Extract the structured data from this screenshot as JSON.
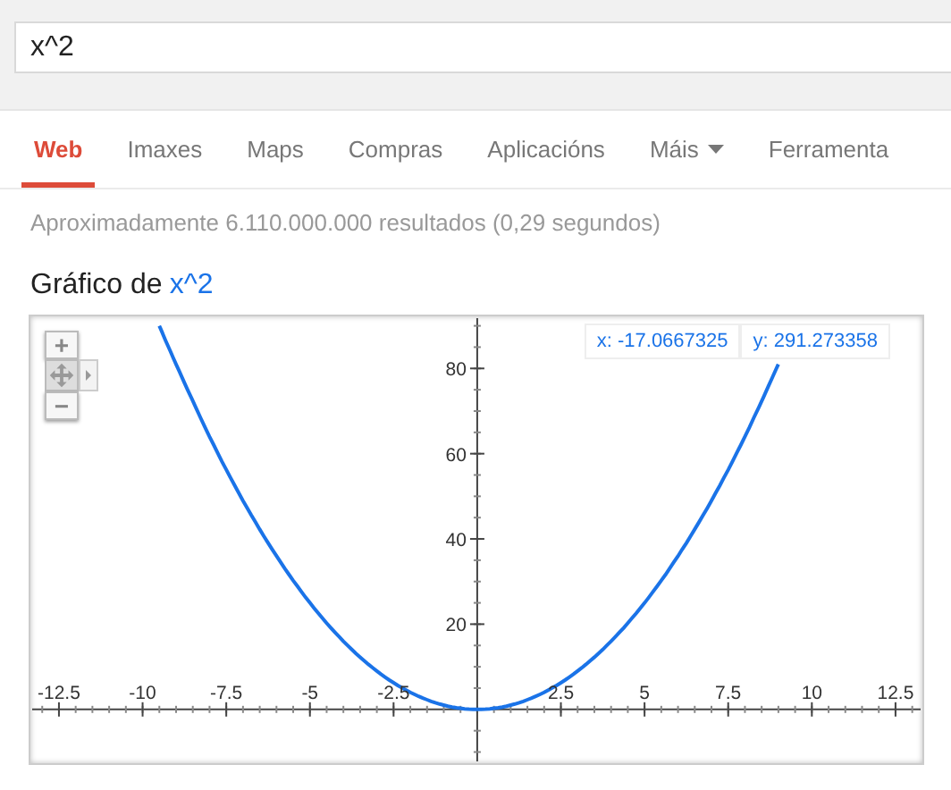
{
  "search": {
    "value": "x^2"
  },
  "tabs": [
    {
      "label": "Web",
      "selected": true,
      "kind": "plain"
    },
    {
      "label": "Imaxes",
      "selected": false,
      "kind": "plain"
    },
    {
      "label": "Maps",
      "selected": false,
      "kind": "plain"
    },
    {
      "label": "Compras",
      "selected": false,
      "kind": "plain"
    },
    {
      "label": "Aplicacións",
      "selected": false,
      "kind": "plain"
    },
    {
      "label": "Máis",
      "selected": false,
      "kind": "dropdown"
    },
    {
      "label": "Ferramenta",
      "selected": false,
      "kind": "plain"
    }
  ],
  "result_stats": "Aproximadamente 6.110.000.000 resultados (0,29 segundos)",
  "graph": {
    "title": "Gráfico de",
    "query": "x^2",
    "readout": {
      "x": "x: -17.0667325",
      "y": "y: 291.273358"
    },
    "chart_data": {
      "type": "line",
      "xlim": [
        -13.3,
        13.25
      ],
      "ylim": [
        -12.2,
        91.8
      ],
      "xticks": [
        {
          "value": -12.5,
          "label": "-12.5"
        },
        {
          "value": -10,
          "label": "-10"
        },
        {
          "value": -7.5,
          "label": "-7.5"
        },
        {
          "value": -5,
          "label": "-5"
        },
        {
          "value": -2.5,
          "label": "-2.5"
        },
        {
          "value": 2.5,
          "label": "2.5"
        },
        {
          "value": 5,
          "label": "5"
        },
        {
          "value": 7.5,
          "label": "7.5"
        },
        {
          "value": 10,
          "label": "10"
        },
        {
          "value": 12.5,
          "label": "12.5"
        }
      ],
      "yticks": [
        20,
        40,
        60,
        80
      ],
      "x": [
        -9.5,
        -9,
        -8,
        -7,
        -6,
        -5,
        -4,
        -3,
        -2,
        -1,
        0,
        1,
        2,
        3,
        4,
        5,
        6,
        7,
        8,
        9
      ],
      "series": [
        {
          "color": "#1a73e8",
          "values": [
            90,
            81,
            64,
            49,
            36,
            25,
            16,
            9,
            4,
            1,
            0,
            1,
            4,
            9,
            16,
            25,
            36,
            49,
            64,
            81
          ]
        }
      ]
    },
    "zoom_controls": {
      "zoom_in": "+",
      "zoom_out": "−"
    }
  }
}
